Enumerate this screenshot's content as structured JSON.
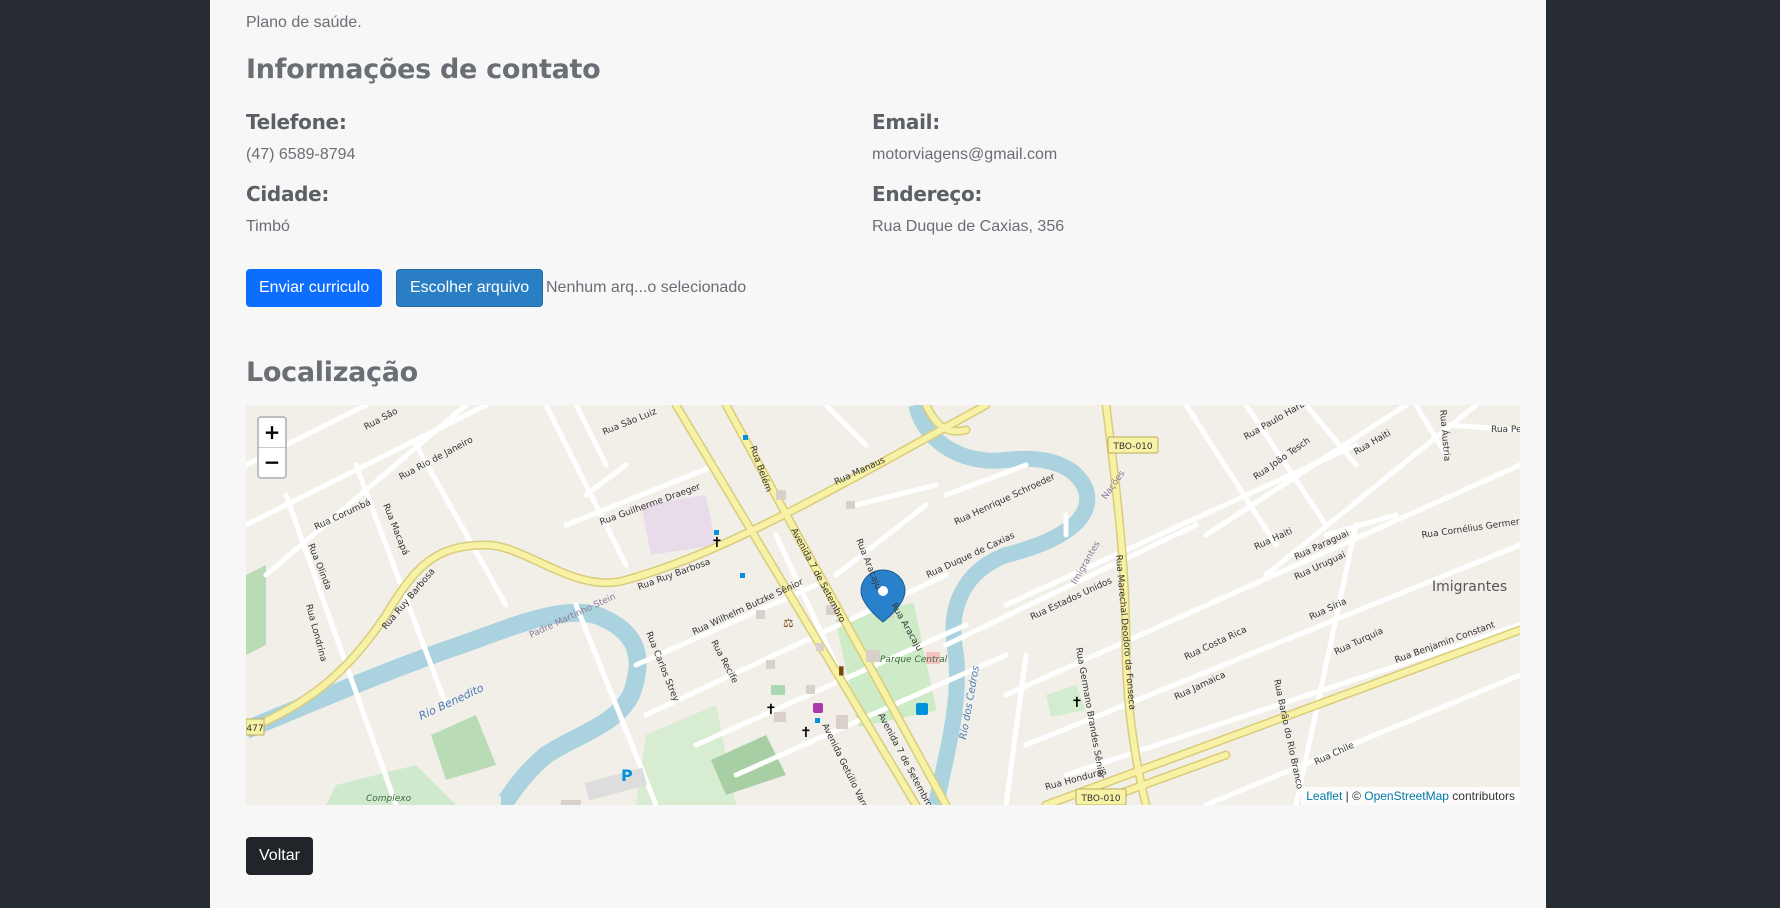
{
  "intro_text": "Plano de saúde.",
  "contact": {
    "heading": "Informações de contato",
    "phone_label": "Telefone:",
    "phone_value": "(47) 6589-8794",
    "email_label": "Email:",
    "email_value": "motorviagens@gmail.com",
    "city_label": "Cidade:",
    "city_value": "Timbó",
    "address_label": "Endereço:",
    "address_value": "Rua Duque de Caxias, 356"
  },
  "actions": {
    "send_cv_label": "Enviar curriculo",
    "choose_file_label": "Escolher arquivo",
    "file_status": "Nenhum arq...o selecionado"
  },
  "location": {
    "heading": "Localização",
    "zoom_in": "+",
    "zoom_out": "−",
    "attribution_leaflet": "Leaflet",
    "attribution_sep": " | © ",
    "attribution_osm": "OpenStreetMap",
    "attribution_tail": " contributors",
    "labels": {
      "rua_ruy_barbosa": "Rua Ruy Barbosa",
      "rua_manaus": "Rua Manaus",
      "rua_belem": "Rua Belém",
      "avenida_7_setembro": "Avenida 7 de Setembro",
      "rua_duque_caxias": "Rua Duque de Caxias",
      "rua_aracaju": "Rua Aracaju",
      "rua_henrique_schroeder": "Rua Henrique Schroeder",
      "rua_guilherme_draeger": "Rua Guilherme Draeger",
      "rua_wilhelm_butzke": "Rua Wilhelm Butzke Sênior",
      "rua_recife": "Rua Recife",
      "rua_carlos_strey": "Rua Carlos Strey",
      "rio_benedito": "Rio Benedito",
      "rio_dos_cedros": "Rio dos Cedros",
      "padre_martinho_stein": "Padre Martinho Stein",
      "parque_central": "Parque Central",
      "rua_corumba": "Rua Corumbá",
      "rua_macapa": "Rua Macapá",
      "rua_olinda": "Rua Olinda",
      "rua_londrina": "Rua Londrina",
      "rua_rio_de_janeiro": "Rua Rio de Janeiro",
      "rua_sao_luiz": "Rua São Luiz",
      "rua_sao_paulo": "Rua São",
      "tbo_010": "TBO-010",
      "imigrantes": "Imigrantes",
      "rua_estados_unidos": "Rua Estados Unidos",
      "rua_marechal": "Rua Marechal Deodoro da Fonseca",
      "rua_haiti": "Rua Haiti",
      "rua_paraguai": "Rua Paraguai",
      "rua_uruguai": "Rua Uruguai",
      "rua_costa_rica": "Rua Costa Rica",
      "rua_siria": "Rua Síria",
      "rua_turquia": "Rua Turquia",
      "rua_jamaica": "Rua Jamaica",
      "rua_chile": "Rua Chile",
      "rua_benjamin_constant": "Rua Benjamin Constant",
      "rua_cornelius_germer": "Rua Cornélius Germer",
      "rua_joao_tesch": "Rua João Tesch",
      "rua_paulo_harbs": "Rua Paulo Harbs",
      "rua_austria": "Rua Áustria",
      "rua_honduras": "Rua Honduras",
      "rua_germano": "Rua Germano Brandes Sênior",
      "rua_barao": "Rua Barão do Rio Branco",
      "avenida_getulio": "Avenida Getúlio Vargas",
      "nacoes": "Nações",
      "complexo": "Complexo",
      "num_477": "477",
      "rua_pe": "Rua Pe"
    }
  },
  "back_label": "Voltar",
  "colors": {
    "primary": "#0d6efd",
    "file_button": "#2a7fc4",
    "dark_button": "#212529",
    "page_bg": "#f7f7f7",
    "outer_bg": "#272b33",
    "marker": "#2a81cb"
  }
}
